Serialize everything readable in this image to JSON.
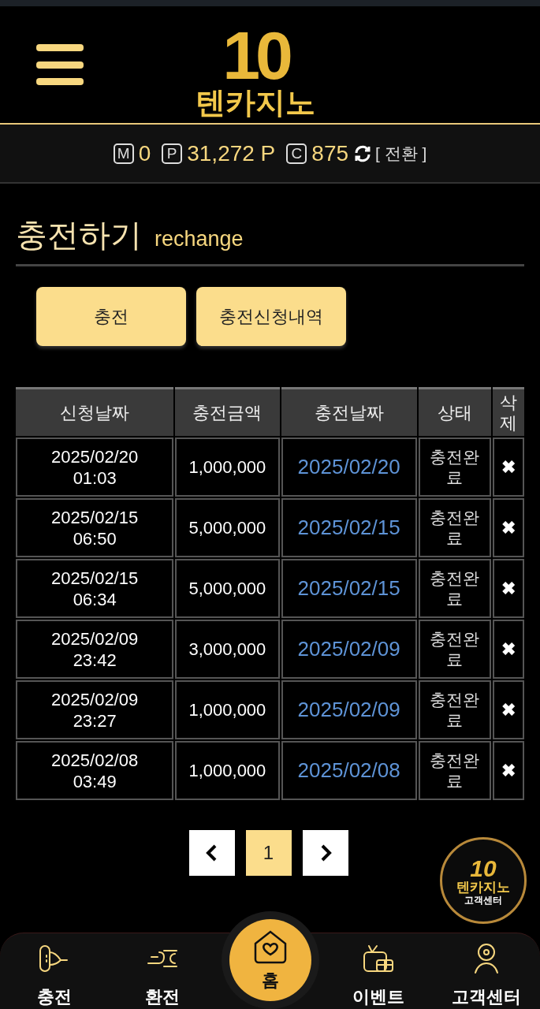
{
  "header": {
    "logo_number": "10",
    "logo_text": "텐카지노"
  },
  "balance": {
    "items": [
      {
        "symbol": "M",
        "value": "0"
      },
      {
        "symbol": "P",
        "value": "31,272 P"
      },
      {
        "symbol": "C",
        "value": "875"
      }
    ],
    "convert": "[ 전환 ]"
  },
  "page_title": {
    "title": "충전하기",
    "subtitle": "rechange"
  },
  "buttons": [
    "충전",
    "충전신청내역"
  ],
  "table": {
    "columns": [
      "신청날짜",
      "충전금액",
      "충전날짜",
      "상태",
      "삭제"
    ],
    "rows": [
      {
        "requested": "2025/02/20 01:03",
        "amount": "1,000,000",
        "charged": "2025/02/20",
        "status": "충전완료",
        "delete": "✖"
      },
      {
        "requested": "2025/02/15 06:50",
        "amount": "5,000,000",
        "charged": "2025/02/15",
        "status": "충전완료",
        "delete": "✖"
      },
      {
        "requested": "2025/02/15 06:34",
        "amount": "5,000,000",
        "charged": "2025/02/15",
        "status": "충전완료",
        "delete": "✖"
      },
      {
        "requested": "2025/02/09 23:42",
        "amount": "3,000,000",
        "charged": "2025/02/09",
        "status": "충전완료",
        "delete": "✖"
      },
      {
        "requested": "2025/02/09 23:27",
        "amount": "1,000,000",
        "charged": "2025/02/09",
        "status": "충전완료",
        "delete": "✖"
      },
      {
        "requested": "2025/02/08 03:49",
        "amount": "1,000,000",
        "charged": "2025/02/08",
        "status": "충전완료",
        "delete": "✖"
      }
    ]
  },
  "pagination": {
    "pages": [
      {
        "label": "1",
        "selected": true
      }
    ]
  },
  "support_badge": {
    "number": "10",
    "logo_text": "텐카지노",
    "label": "고객센터"
  },
  "bottom_nav": [
    {
      "kind": "deposit",
      "label": "충전"
    },
    {
      "kind": "withdraw",
      "label": "환전"
    },
    {
      "kind": "home",
      "label": "홈"
    },
    {
      "kind": "event",
      "label": "이벤트"
    },
    {
      "kind": "support",
      "label": "고객센터"
    }
  ]
}
